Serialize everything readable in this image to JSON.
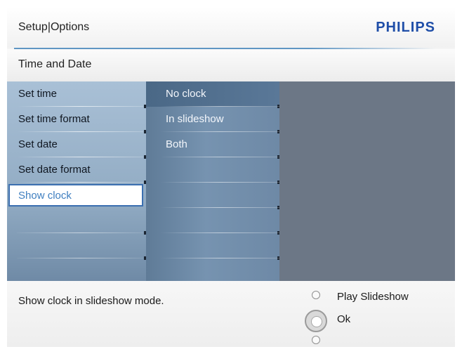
{
  "header": {
    "title": "Setup|Options",
    "brand": "PHILIPS"
  },
  "section": {
    "title": "Time and Date"
  },
  "left_menu": {
    "items": [
      {
        "label": "Set time"
      },
      {
        "label": "Set time format"
      },
      {
        "label": "Set date"
      },
      {
        "label": "Set date format"
      },
      {
        "label": "Show clock",
        "selected": true
      }
    ]
  },
  "sub_menu": {
    "items": [
      {
        "label": "No clock",
        "active": true
      },
      {
        "label": "In slideshow"
      },
      {
        "label": "Both"
      }
    ]
  },
  "footer": {
    "help_text": "Show clock in slideshow mode.",
    "hints": {
      "play": "Play Slideshow",
      "ok": "Ok"
    }
  },
  "colors": {
    "brand": "#1f4ea8",
    "selected_text": "#3f7fc0",
    "selected_border": "#3b6fb0",
    "panel": "#6c7786"
  },
  "icons": {
    "nav_up": "circle-icon",
    "nav_center": "ok-button-icon",
    "nav_down": "circle-icon"
  }
}
